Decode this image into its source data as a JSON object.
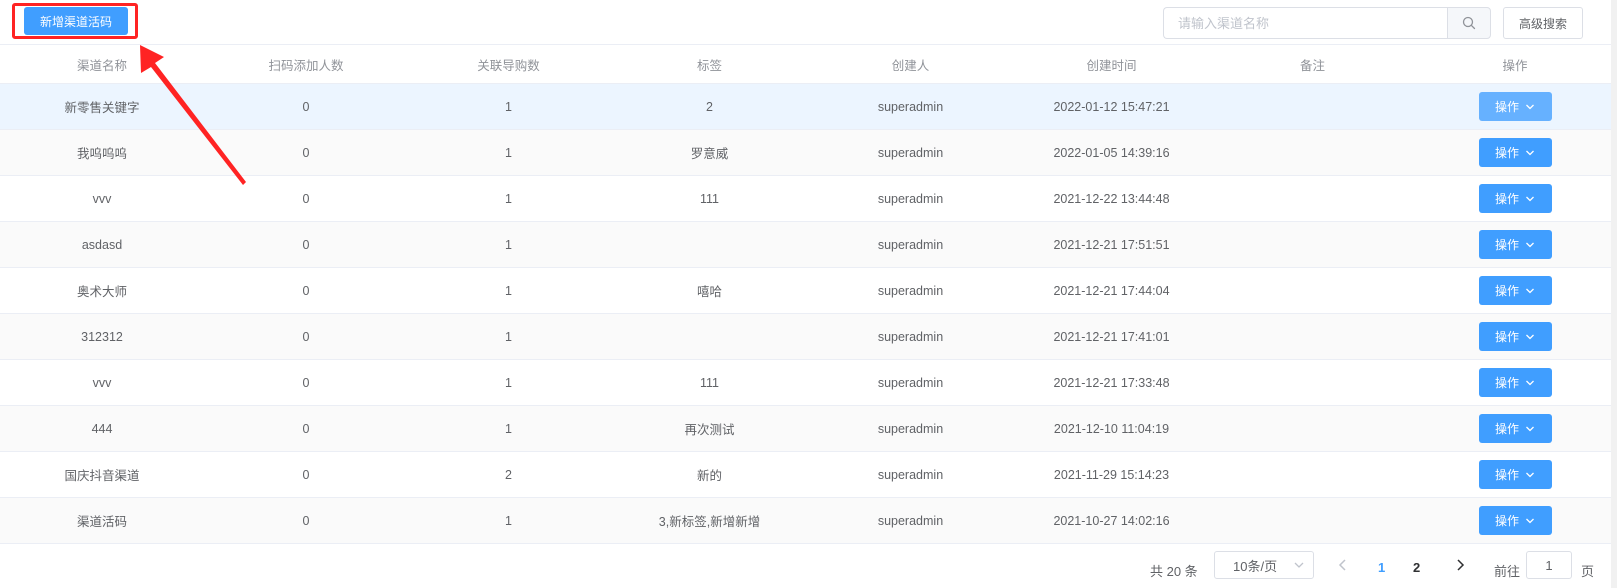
{
  "toolbar": {
    "add_button": "新增渠道活码",
    "search_placeholder": "请输入渠道名称",
    "advanced_search": "高级搜索"
  },
  "table": {
    "columns": [
      "渠道名称",
      "扫码添加人数",
      "关联导购数",
      "标签",
      "创建人",
      "创建时间",
      "备注",
      "操作"
    ],
    "rows": [
      {
        "name": "新零售关键字",
        "scans": "0",
        "guides": "1",
        "tags": "2",
        "creator": "superadmin",
        "created": "2022-01-12 15:47:21",
        "remark": "",
        "action": "操作"
      },
      {
        "name": "我呜呜呜",
        "scans": "0",
        "guides": "1",
        "tags": "罗意威",
        "creator": "superadmin",
        "created": "2022-01-05 14:39:16",
        "remark": "",
        "action": "操作"
      },
      {
        "name": "vvv",
        "scans": "0",
        "guides": "1",
        "tags": "111",
        "creator": "superadmin",
        "created": "2021-12-22 13:44:48",
        "remark": "",
        "action": "操作"
      },
      {
        "name": "asdasd",
        "scans": "0",
        "guides": "1",
        "tags": "",
        "creator": "superadmin",
        "created": "2021-12-21 17:51:51",
        "remark": "",
        "action": "操作"
      },
      {
        "name": "奥术大师",
        "scans": "0",
        "guides": "1",
        "tags": "嘻哈",
        "creator": "superadmin",
        "created": "2021-12-21 17:44:04",
        "remark": "",
        "action": "操作"
      },
      {
        "name": "312312",
        "scans": "0",
        "guides": "1",
        "tags": "",
        "creator": "superadmin",
        "created": "2021-12-21 17:41:01",
        "remark": "",
        "action": "操作"
      },
      {
        "name": "vvv",
        "scans": "0",
        "guides": "1",
        "tags": "111",
        "creator": "superadmin",
        "created": "2021-12-21 17:33:48",
        "remark": "",
        "action": "操作"
      },
      {
        "name": "444",
        "scans": "0",
        "guides": "1",
        "tags": "再次测试",
        "creator": "superadmin",
        "created": "2021-12-10 11:04:19",
        "remark": "",
        "action": "操作"
      },
      {
        "name": "国庆抖音渠道",
        "scans": "0",
        "guides": "2",
        "tags": "新的",
        "creator": "superadmin",
        "created": "2021-11-29 15:14:23",
        "remark": "",
        "action": "操作"
      },
      {
        "name": "渠道活码",
        "scans": "0",
        "guides": "1",
        "tags": "3,新标签,新增新增",
        "creator": "superadmin",
        "created": "2021-10-27 14:02:16",
        "remark": "",
        "action": "操作"
      }
    ]
  },
  "pagination": {
    "total": "共 20 条",
    "page_size": "10条/页",
    "pages": [
      "1",
      "2"
    ],
    "current_page": "1",
    "goto_label": "前往",
    "goto_value": "1",
    "goto_suffix": "页"
  },
  "colors": {
    "primary": "#409eff",
    "annotation": "#ff2323"
  },
  "icons": [
    "search-icon",
    "chevron-down-icon",
    "chevron-left-icon",
    "chevron-right-icon"
  ]
}
